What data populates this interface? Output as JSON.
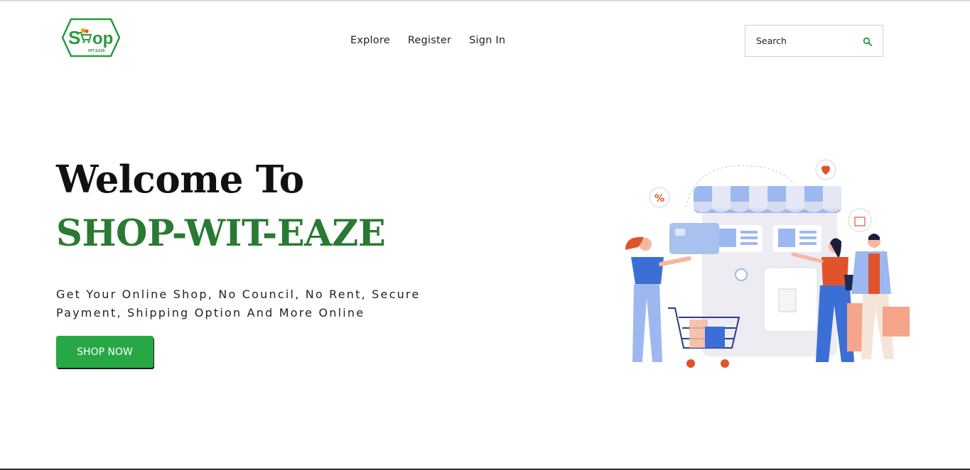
{
  "brand": {
    "logo_text": "Shop",
    "logo_subtext": "WIT-EAZE",
    "color": "#2a9a3e"
  },
  "nav": {
    "items": [
      {
        "label": "Explore"
      },
      {
        "label": "Register"
      },
      {
        "label": "Sign In"
      }
    ]
  },
  "search": {
    "placeholder": "Search",
    "icon": "search-icon"
  },
  "hero": {
    "line1": "Welcome To",
    "line2": "SHOP-WIT-EAZE",
    "tagline": "Get Your Online Shop, No Council, No Rent, Secure Payment, Shipping Option And More Online",
    "cta_label": "SHOP NOW",
    "accent_color": "#2a7a33",
    "button_color": "#28a745"
  },
  "illustration": {
    "badge_text": "%"
  }
}
